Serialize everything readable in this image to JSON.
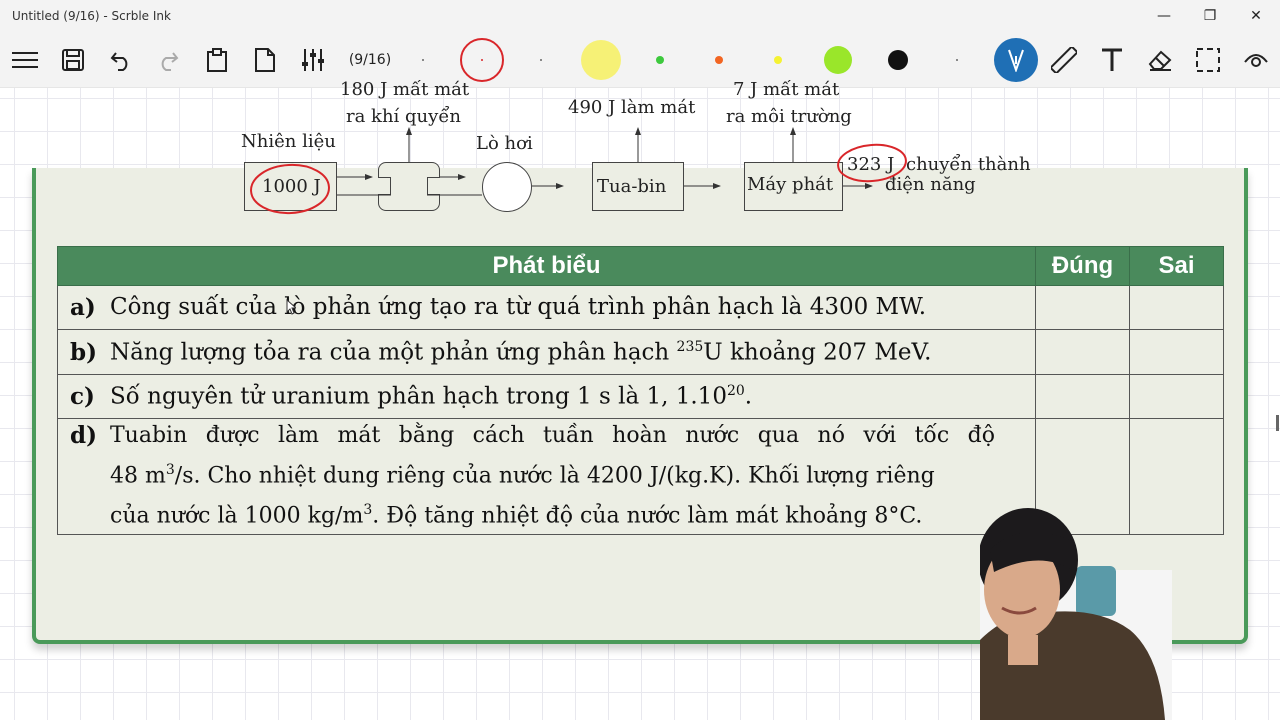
{
  "window": {
    "title": "Untitled (9/16) - Scrble Ink",
    "controls": [
      "—",
      "❐",
      "✕"
    ]
  },
  "toolbar": {
    "page_indicator": "(9/16)",
    "icons": [
      "menu-icon",
      "save-icon",
      "undo-icon",
      "redo-icon",
      "clipboard-icon",
      "page-icon",
      "sliders-icon"
    ],
    "pen_colors": [
      "#d9262a",
      "#f6f176",
      "#3dc93d",
      "#f26522",
      "#f5f232",
      "#9ae62a",
      "#111111"
    ],
    "tools": [
      "pen-icon",
      "ruler-icon",
      "text-icon",
      "eraser-icon",
      "lasso-icon",
      "eye-icon"
    ]
  },
  "diagram": {
    "fuel_label": "Nhiên liệu",
    "fuel_value": "1000 J",
    "loss_atmos_1": "180 J mất mát",
    "loss_atmos_2": "ra khí quyển",
    "boiler_label": "Lò hơi",
    "cooling": "490 J làm mát",
    "turbine": "Tua-bin",
    "loss_env_1": "7 J mất mát",
    "loss_env_2": "ra môi trường",
    "generator": "Máy phát",
    "output_value": "323 J",
    "output_text_1": "chuyển thành",
    "output_text_2": "điện năng"
  },
  "table": {
    "headers": [
      "Phát biểu",
      "Đúng",
      "Sai"
    ],
    "rows": [
      {
        "label": "a)",
        "text": "Công suất của lò phản ứng tạo ra từ quá trình phân hạch là 4300 MW."
      },
      {
        "label": "b)",
        "text_pre": "Năng lượng tỏa ra của một phản ứng phân hạch ",
        "sup": "235",
        "text_post": "U khoảng 207 MeV."
      },
      {
        "label": "c)",
        "text_pre": "Số nguyên tử uranium phân hạch trong 1 s là 1, 1.10",
        "sup": "20",
        "text_post": "."
      },
      {
        "label": "d)",
        "line1": "Tuabin được làm mát bằng cách tuần hoàn nước qua nó với tốc độ",
        "line2_pre": "48 m",
        "line2_sup": "3",
        "line2_post": "/s. Cho nhiệt dung riêng của nước là 4200 J/(kg.K). Khối lượng riêng",
        "line3_pre": "của nước là 1000 kg/m",
        "line3_sup": "3",
        "line3_post": ". Độ tăng nhiệt độ của nước làm mát khoảng 8°C."
      }
    ]
  }
}
